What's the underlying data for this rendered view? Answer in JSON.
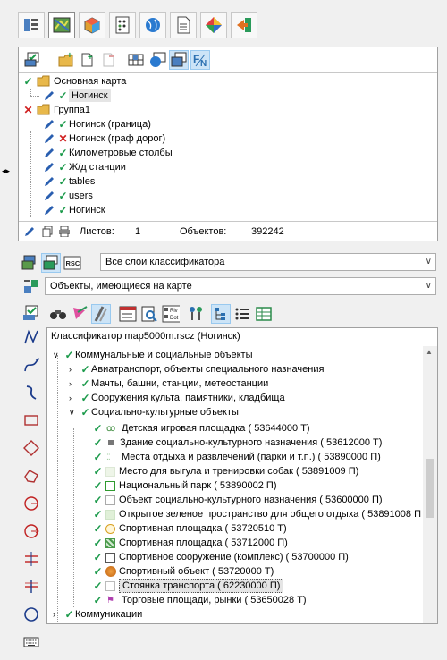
{
  "top_tabs": [
    {
      "icon": "layers-list-icon",
      "active": false
    },
    {
      "icon": "map-icon",
      "active": true
    },
    {
      "icon": "cube-icon",
      "active": false
    },
    {
      "icon": "table-grid-icon",
      "active": false
    },
    {
      "icon": "globe-icon",
      "active": false
    },
    {
      "icon": "document-icon",
      "active": false
    },
    {
      "icon": "diamond-compass-icon",
      "active": false
    },
    {
      "icon": "exit-arrow-icon",
      "active": false
    }
  ],
  "layers": {
    "toolbar": [
      "select-layers-icon",
      "add-folder-icon",
      "add-document-icon",
      "remove-document-icon",
      "map-grid-icon",
      "globe-grid-icon",
      "copy-maps-icon",
      "function-fn-icon"
    ],
    "tree": [
      {
        "label": "Основная карта",
        "state": "check",
        "type": "folder",
        "level": 0
      },
      {
        "label": "Ногинск",
        "state": "check",
        "type": "map",
        "level": 1,
        "selected": true
      },
      {
        "label": "Группа1",
        "state": "cross",
        "type": "folder",
        "level": 0
      },
      {
        "label": "Ногинск (граница)",
        "state": "check",
        "type": "map",
        "level": 1
      },
      {
        "label": "Ногинск (граф дорог)",
        "state": "cross",
        "type": "map",
        "level": 1
      },
      {
        "label": "Километровые столбы",
        "state": "check",
        "type": "map",
        "level": 1
      },
      {
        "label": "Ж/д станции",
        "state": "check",
        "type": "map",
        "level": 1
      },
      {
        "label": "tables",
        "state": "check",
        "type": "map",
        "level": 1
      },
      {
        "label": "users",
        "state": "check",
        "type": "map",
        "level": 1
      },
      {
        "label": "Ногинск",
        "state": "check",
        "type": "map",
        "level": 1
      }
    ],
    "status": {
      "sheets_label": "Листов:",
      "sheets_value": "1",
      "objects_label": "Объектов:",
      "objects_value": "392242"
    }
  },
  "classifier": {
    "layer_select": "Все слои классификатора",
    "object_select": "Объекты, имеющиеся на карте",
    "title": "Классификатор map5000m.rscz (Ногинск)",
    "tree": [
      {
        "label": "Коммунальные и социальные объекты",
        "level": 0,
        "expander": "v"
      },
      {
        "label": "Авиатранспорт, объекты специального назначения",
        "level": 1,
        "expander": ">"
      },
      {
        "label": "Мачты, башни, станции, метеостанции",
        "level": 1,
        "expander": ">"
      },
      {
        "label": "Сооружения культа, памятники, кладбища",
        "level": 1,
        "expander": ">"
      },
      {
        "label": "Социально-культурные объекты",
        "level": 1,
        "expander": "v"
      },
      {
        "label": "Детская игровая площадка ( 53644000 Т)",
        "level": 2,
        "swatch": "kids",
        "color": "#3a8a3a"
      },
      {
        "label": "Здание социально-культурного назначения ( 53612000 Т)",
        "level": 2,
        "swatch": "square",
        "color": "#777777"
      },
      {
        "label": "Места отдыха и развлечений (парки и т.п.) ( 53890000 П)",
        "level": 2,
        "swatch": "dots",
        "color": "#9ac99a"
      },
      {
        "label": "Место для выгула и тренировки собак ( 53891009 П)",
        "level": 2,
        "swatch": "pale",
        "color": "#eef5e8"
      },
      {
        "label": "Национальный парк ( 53890002 П)",
        "level": 2,
        "swatch": "outline",
        "color": "#2f9a2f"
      },
      {
        "label": "Объект социально-культурного назначения ( 53600000 П)",
        "level": 2,
        "swatch": "outline",
        "color": "#aaaaaa"
      },
      {
        "label": "Открытое зеленое пространство для общего отдыха ( 53891008 П)",
        "level": 2,
        "swatch": "pale",
        "color": "#e0f0d8"
      },
      {
        "label": "Спортивная площадка ( 53720510 Т)",
        "level": 2,
        "swatch": "circle",
        "color": "#d8a020"
      },
      {
        "label": "Спортивная площадка ( 53712000 П)",
        "level": 2,
        "swatch": "hatch",
        "color": "#4a9a4a"
      },
      {
        "label": "Спортивное сооружение (комплекс) ( 53700000 П)",
        "level": 2,
        "swatch": "outline",
        "color": "#555555"
      },
      {
        "label": "Спортивный объект ( 53720000 Т)",
        "level": 2,
        "swatch": "ball",
        "color": "#d07020"
      },
      {
        "label": "Стоянка транспорта ( 62230000 П)",
        "level": 2,
        "swatch": "outline",
        "color": "#bbbbbb",
        "selected": true
      },
      {
        "label": "Торговые площади, рынки ( 53650028 Т)",
        "level": 2,
        "swatch": "flag",
        "color": "#b040b0"
      },
      {
        "label": "Коммуникации",
        "level": 0,
        "expander": ">"
      }
    ]
  },
  "left_tools": [
    "polyline-icon",
    "curve-tool-icon",
    "spline-icon",
    "rectangle-icon",
    "diamond-icon",
    "polygon-icon",
    "circle-arc-icon",
    "circle-arrow-icon",
    "parallel-line-icon",
    "cross-line-icon",
    "circle-tool-icon",
    "keyboard-icon"
  ],
  "colors": {
    "check": "#1b9a4a",
    "cross": "#d02020",
    "select_blue": "#cce4f7",
    "folder": "#e8b84a"
  }
}
